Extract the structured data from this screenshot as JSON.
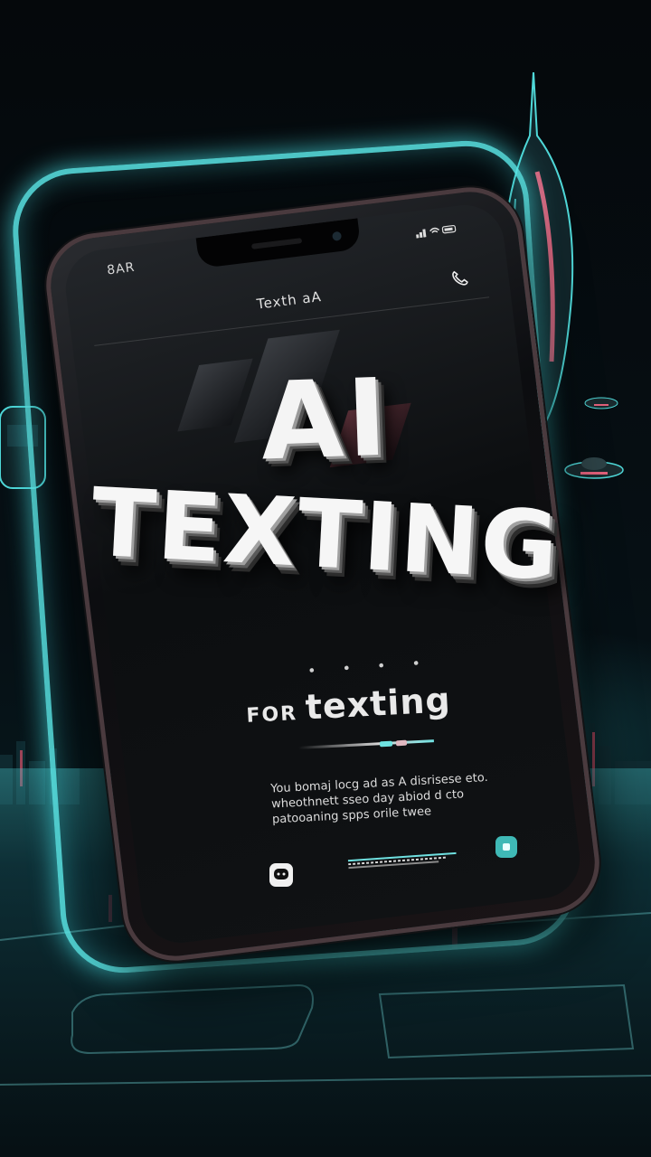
{
  "colors": {
    "accent_cyan": "#4fd8d8",
    "accent_pink": "#e0607a",
    "background": "#05080b",
    "title_white": "#f4f4f4"
  },
  "phone": {
    "status_time": "8AR",
    "status_icons": "signal-wifi-battery-icons",
    "header_title": "Texth aA",
    "header_icon": "phone-call-icon"
  },
  "headline": {
    "line1": "AI",
    "line2": "TEXTING"
  },
  "tagline": {
    "prefix": "FOR",
    "main": "texting",
    "dots": "• • • •"
  },
  "body_text": "You bomaj locg ad as A disrisese eto. wheothnett sseo day abiod d cto patooaning spps orile twee",
  "buttons": {
    "left_icon": "chat-bubble-icon",
    "right_icon": "record-icon"
  }
}
